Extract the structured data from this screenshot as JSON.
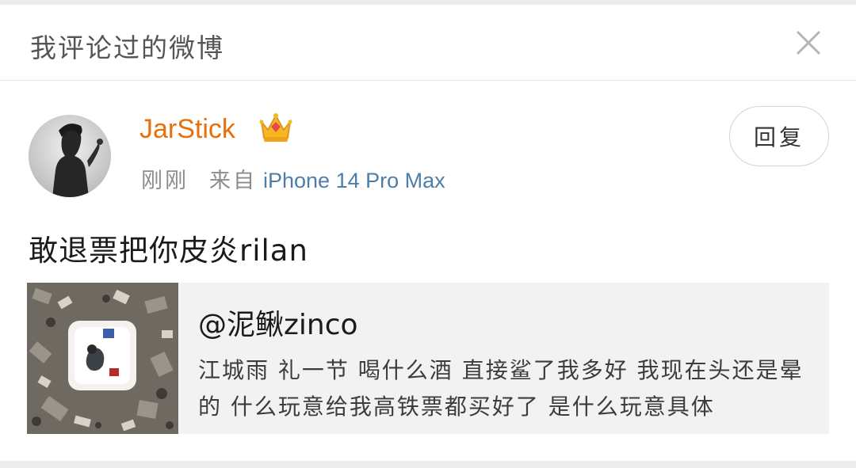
{
  "header": {
    "title": "我评论过的微博",
    "close_icon": "close-icon"
  },
  "comment": {
    "username": "JarStick",
    "badge_icon": "crown-icon",
    "time": "刚刚",
    "from_label": "来自",
    "device": "iPhone 14 Pro Max",
    "reply_label": "回复",
    "text": "敢退票把你皮炎rilan"
  },
  "quoted_post": {
    "author": "@泥鳅zinco",
    "body": "江城雨 礼一节 喝什么酒 直接鲨了我多好 我现在头还是晕的 什么玩意给我高铁票都买好了 是什么玩意具体"
  },
  "colors": {
    "username": "#e86f0a",
    "device_link": "#4d7ea8",
    "card_bg": "#f2f2f2"
  }
}
